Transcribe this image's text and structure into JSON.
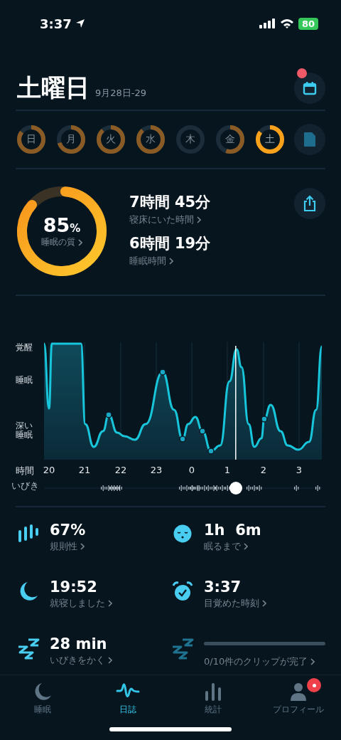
{
  "status_bar": {
    "time": "3:37",
    "battery": "80"
  },
  "header": {
    "title": "土曜日",
    "date": "9月28日-29",
    "calendar_badge": true
  },
  "days": [
    {
      "label": "日",
      "selected": false
    },
    {
      "label": "月",
      "selected": false
    },
    {
      "label": "火",
      "selected": false
    },
    {
      "label": "水",
      "selected": false
    },
    {
      "label": "木",
      "selected": false
    },
    {
      "label": "金",
      "selected": false
    },
    {
      "label": "土",
      "selected": true
    }
  ],
  "summary": {
    "quality": {
      "value": "85",
      "unit": "%",
      "label": "睡眠の質"
    },
    "durations": [
      {
        "value": "7時間 45分",
        "label": "寝床にいた時間"
      },
      {
        "value": "6時間 19分",
        "label": "睡眠時間"
      }
    ]
  },
  "chart": {
    "y_labels": [
      "覚醒",
      "睡眠",
      "深い睡眠"
    ],
    "x_label": "時間",
    "hours": [
      "20",
      "21",
      "22",
      "23",
      "0",
      "1",
      "2",
      "3"
    ],
    "snore_label": "いびき"
  },
  "stats": [
    {
      "kind": "regularity",
      "value": "67%",
      "label": "規則性"
    },
    {
      "kind": "latency",
      "value": "1h  6m",
      "label": "眠るまで"
    },
    {
      "kind": "bedtime",
      "value": "19:52",
      "label": "就寝しました"
    },
    {
      "kind": "wake",
      "value": "3:37",
      "label": "目覚めた時刻"
    },
    {
      "kind": "snoring",
      "value": "28 min",
      "label": "いびきをかく"
    },
    {
      "kind": "clips",
      "label": "0/10件のクリップが完了"
    }
  ],
  "tabs": [
    {
      "kind": "sleep",
      "label": "睡眠",
      "selected": false,
      "badge": false
    },
    {
      "kind": "journal",
      "label": "日誌",
      "selected": true,
      "badge": false
    },
    {
      "kind": "stats",
      "label": "統計",
      "selected": false,
      "badge": false
    },
    {
      "kind": "profile",
      "label": "プロフィール",
      "selected": false,
      "badge": true
    }
  ]
}
